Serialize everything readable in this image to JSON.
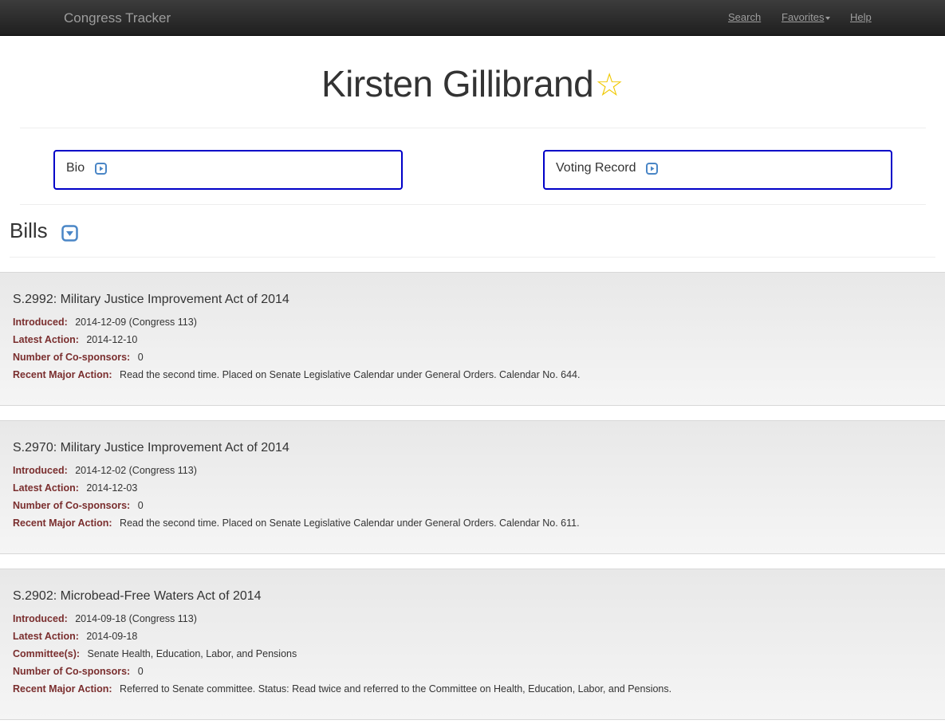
{
  "navbar": {
    "brand": "Congress Tracker",
    "search_label": "Search",
    "favorites_label": "Favorites",
    "help_label": "Help"
  },
  "page": {
    "title": "Kirsten Gillibrand",
    "favorite_star": "☆"
  },
  "panels": {
    "bio_label": "Bio",
    "voting_label": "Voting Record"
  },
  "bills_section": {
    "title": "Bills"
  },
  "bills": [
    {
      "title": "S.2992: Military Justice Improvement Act of 2014",
      "introduced_label": "Introduced:",
      "introduced": "2014-12-09 (Congress 113)",
      "latest_label": "Latest Action:",
      "latest": "2014-12-10",
      "cosponsors_label": "Number of Co-sponsors:",
      "cosponsors": "0",
      "major_label": "Recent Major Action:",
      "major": "Read the second time. Placed on Senate Legislative Calendar under General Orders. Calendar No. 644."
    },
    {
      "title": "S.2970: Military Justice Improvement Act of 2014",
      "introduced_label": "Introduced:",
      "introduced": "2014-12-02 (Congress 113)",
      "latest_label": "Latest Action:",
      "latest": "2014-12-03",
      "cosponsors_label": "Number of Co-sponsors:",
      "cosponsors": "0",
      "major_label": "Recent Major Action:",
      "major": "Read the second time. Placed on Senate Legislative Calendar under General Orders. Calendar No. 611."
    },
    {
      "title": "S.2902: Microbead-Free Waters Act of 2014",
      "introduced_label": "Introduced:",
      "introduced": "2014-09-18 (Congress 113)",
      "latest_label": "Latest Action:",
      "latest": "2014-09-18",
      "committee_label": "Committee(s):",
      "committee": "Senate Health, Education, Labor, and Pensions",
      "cosponsors_label": "Number of Co-sponsors:",
      "cosponsors": "0",
      "major_label": "Recent Major Action:",
      "major": "Referred to Senate committee. Status: Read twice and referred to the Committee on Health, Education, Labor, and Pensions."
    }
  ],
  "colors": {
    "panel_border": "#0000c8",
    "icon_blue": "#4a86c6",
    "star": "#f0c800",
    "label_red": "#7a2e2e"
  }
}
